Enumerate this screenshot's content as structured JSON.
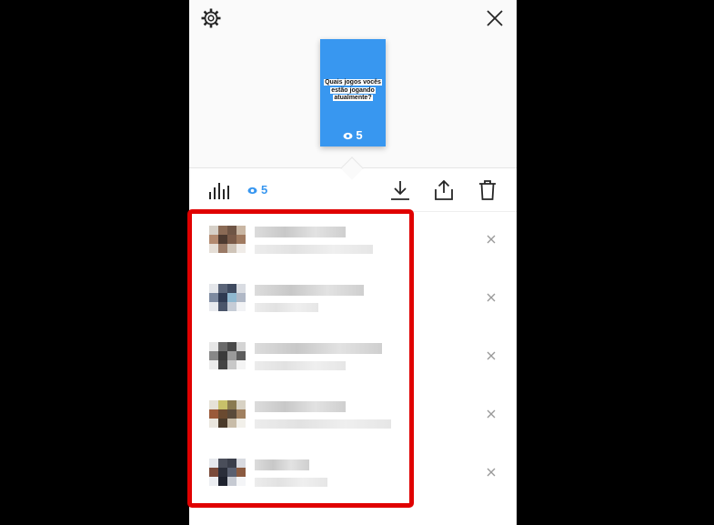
{
  "story": {
    "text": "Quais jogos vocês estão jogando atualmente?",
    "views": "5"
  },
  "toolbar": {
    "views": "5"
  },
  "viewers": [
    {
      "name_w": 100,
      "sub_w": 130,
      "colors": [
        "#d6d0c8",
        "#8a6a55",
        "#6f5545",
        "#c9b6a3",
        "#b38a70",
        "#4d3a30",
        "#7a5a48",
        "#a07a60",
        "#e5ded6",
        "#9a7a66",
        "#cfc4b8",
        "#f0ece8"
      ]
    },
    {
      "name_w": 120,
      "sub_w": 70,
      "colors": [
        "#e4e6ea",
        "#5a6478",
        "#3f4a60",
        "#d9dce2",
        "#7d8aa0",
        "#2f3a52",
        "#8fb8d0",
        "#b0b8c6",
        "#e8eaee",
        "#4a556a",
        "#c6ccd6",
        "#f2f3f5"
      ]
    },
    {
      "name_w": 140,
      "sub_w": 100,
      "colors": [
        "#e6e6e6",
        "#6a6a6a",
        "#4a4a4a",
        "#d4d4d4",
        "#888",
        "#3a3a3a",
        "#9a9a9a",
        "#5c5c5c",
        "#ececec",
        "#444",
        "#c8c8c8",
        "#f4f4f4"
      ]
    },
    {
      "name_w": 100,
      "sub_w": 150,
      "colors": [
        "#e6e2d8",
        "#c8c06a",
        "#8a7a50",
        "#d8d2c4",
        "#9a5a3a",
        "#6a4a30",
        "#5a4a3a",
        "#a08060",
        "#eae6de",
        "#4a3a2a",
        "#c8bca8",
        "#f2f0ea"
      ]
    },
    {
      "name_w": 60,
      "sub_w": 80,
      "colors": [
        "#e6e8ec",
        "#4a4e5a",
        "#3a3e4a",
        "#d8dae0",
        "#7a4a3a",
        "#2a2e3a",
        "#5a6070",
        "#8a5a40",
        "#eceef2",
        "#1e222e",
        "#c6cad2",
        "#f4f5f7"
      ]
    }
  ]
}
